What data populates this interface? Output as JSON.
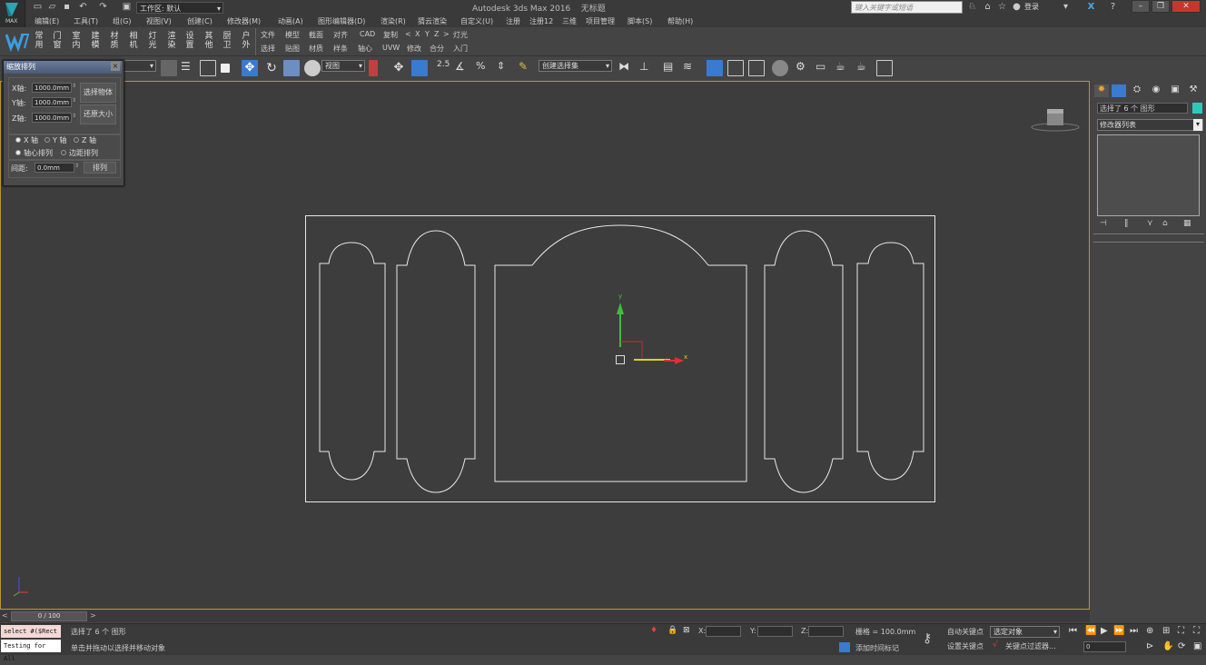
{
  "app": {
    "title": "Autodesk 3ds Max 2016",
    "doc": "无标题",
    "logo_text": "MAX",
    "workspace": "工作区: 默认",
    "search_placeholder": "键入关键字或短语",
    "login": "登录",
    "help": "?"
  },
  "menu": [
    "编辑(E)",
    "工具(T)",
    "组(G)",
    "视图(V)",
    "创建(C)",
    "修改器(M)",
    "动画(A)",
    "图形编辑器(D)",
    "渲染(R)",
    "猜云渲染",
    "自定义(U)",
    "注册",
    "注册12",
    "三维",
    "项目管理",
    "脚本(S)",
    "帮助(H)"
  ],
  "custom_toolbar": {
    "vertical": [
      [
        "常",
        "用"
      ],
      [
        "门",
        "窗"
      ],
      [
        "室",
        "内"
      ],
      [
        "建",
        "模"
      ],
      [
        "材",
        "质"
      ],
      [
        "相",
        "机"
      ],
      [
        "灯",
        "光"
      ],
      [
        "渲",
        "染"
      ],
      [
        "设",
        "置"
      ],
      [
        "其",
        "他"
      ],
      [
        "厨",
        "卫"
      ],
      [
        "户",
        "外"
      ]
    ],
    "row1": [
      "文件",
      "模型",
      "截面",
      "对齐",
      "CAD",
      "复制",
      "<",
      "X",
      "Y",
      "Z",
      ">",
      "灯光"
    ],
    "row2": [
      "选择",
      "贴图",
      "材质",
      "样条",
      "轴心",
      "UVW",
      "修改",
      "合分",
      "入门"
    ]
  },
  "main_toolbar": {
    "view_dropdown": "视图",
    "selection_set": "创建选择集",
    "snap_label": "2.5"
  },
  "float_panel": {
    "title": "缩放排列",
    "x_label": "X轴:",
    "y_label": "Y轴:",
    "z_label": "Z轴:",
    "x_value": "1000.0mm",
    "y_value": "1000.0mm",
    "z_value": "1000.0mm",
    "select_btn": "选择物体",
    "restore_btn": "还原大小",
    "radio_x": "X 轴",
    "radio_y": "Y 轴",
    "radio_z": "Z 轴",
    "radio_pivot": "轴心排列",
    "radio_edge": "边距排列",
    "spacing_label": "间距:",
    "spacing_value": "0.0mm",
    "arrange_btn": "排列"
  },
  "command_panel": {
    "selection_text": "选择了 6 个 图形",
    "modifier_list": "修改器列表"
  },
  "gizmo": {
    "x_label": "x",
    "y_label": "y"
  },
  "timeline": {
    "frame": "0 / 100",
    "prev": "<",
    "next": ">"
  },
  "status": {
    "script_line1": "select #($Rect",
    "script_line2": "Testing for All",
    "status_text": "选择了 6 个 图形",
    "prompt_text": "单击并拖动以选择并移动对象",
    "x_label": "X:",
    "y_label": "Y:",
    "z_label": "Z:",
    "grid": "栅格 = 100.0mm",
    "add_tag": "添加时间标记",
    "auto_key": "自动关键点",
    "set_key": "设置关键点",
    "sel_obj": "选定对象",
    "key_filter": "关键点过滤器...",
    "frame_value": "0"
  },
  "colors": {
    "viewport_border": "#b8962e",
    "gizmo_x": "#e03030",
    "gizmo_y": "#30c030"
  }
}
